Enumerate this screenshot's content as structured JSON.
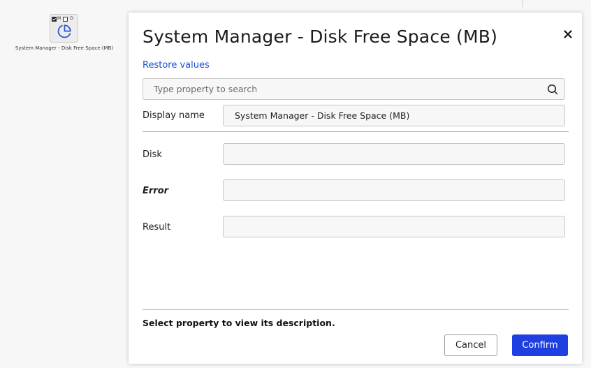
{
  "canvas": {
    "node": {
      "flag_m": "M",
      "flag_d": "D",
      "flag_m_checked": true,
      "flag_d_checked": false,
      "icon": "pie-chart-icon",
      "label": "System Manager - Disk Free Space (MB)"
    }
  },
  "dialog": {
    "title": "System Manager - Disk Free Space (MB)",
    "close_icon": "close-icon",
    "restore_link": "Restore values",
    "search": {
      "placeholder": "Type property to search",
      "value": "",
      "icon": "search-icon"
    },
    "display_name": {
      "label": "Display name",
      "value": "System Manager - Disk Free Space (MB)"
    },
    "properties": [
      {
        "label": "Disk",
        "value": "",
        "emphasized": false
      },
      {
        "label": "Error",
        "value": "",
        "emphasized": true
      },
      {
        "label": "Result",
        "value": "",
        "emphasized": false
      }
    ],
    "description": "Select property to view its description.",
    "cancel_label": "Cancel",
    "confirm_label": "Confirm"
  },
  "colors": {
    "accent": "#1f3fe0",
    "link": "#1d4fd8",
    "field_bg": "#f7f7f7",
    "field_border": "#c6c6c6"
  }
}
